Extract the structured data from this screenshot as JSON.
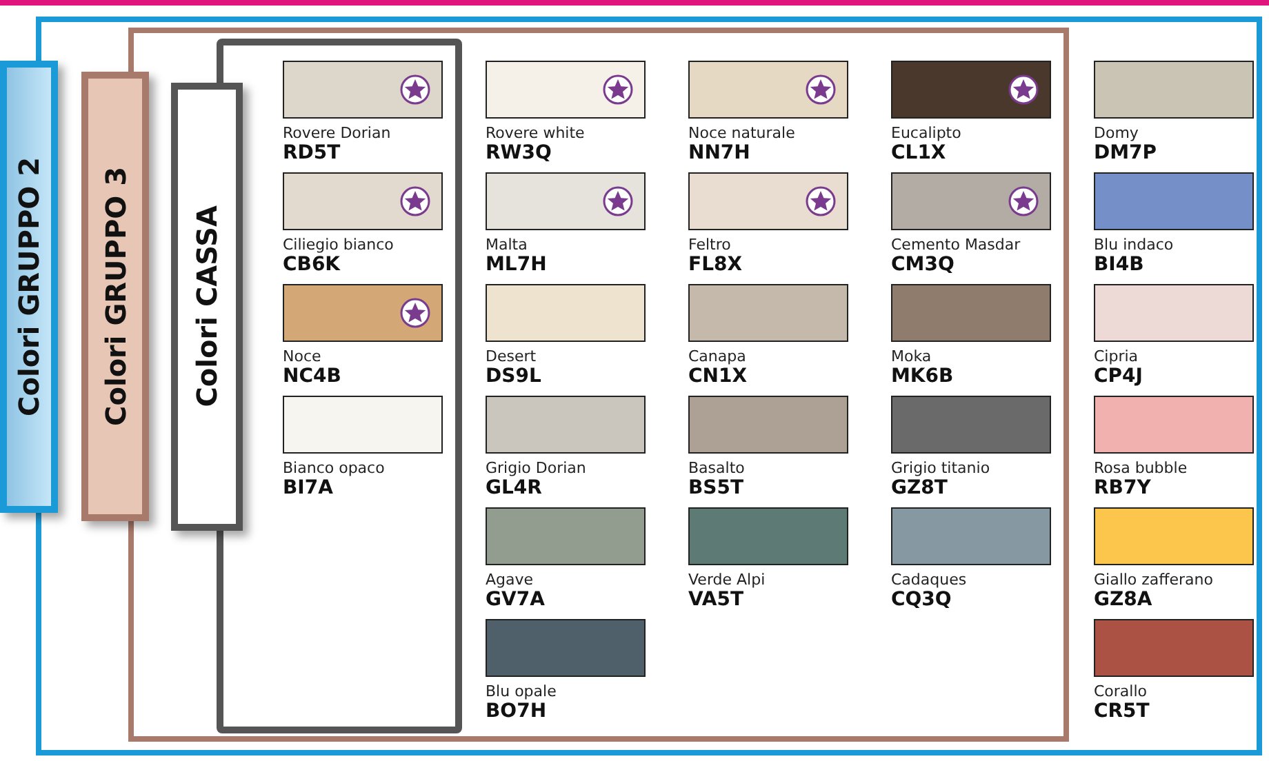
{
  "groups": [
    {
      "label": "Colori GRUPPO 2",
      "color": "#1a9ad6"
    },
    {
      "label": "Colori GRUPPO 3",
      "color": "#a87a6c"
    },
    {
      "label": "Colori CASSA",
      "color": "#555555"
    }
  ],
  "columns": [
    [
      {
        "name": "Rovere Dorian",
        "code": "RD5T",
        "color": "#ddd6cb",
        "starred": true
      },
      {
        "name": "Ciliegio bianco",
        "code": "CB6K",
        "color": "#e2d9cf",
        "starred": true
      },
      {
        "name": "Noce",
        "code": "NC4B",
        "color": "#d4a777",
        "starred": true
      },
      {
        "name": "Bianco opaco",
        "code": "BI7A",
        "color": "#f7f5ef",
        "starred": false
      }
    ],
    [
      {
        "name": "Rovere white",
        "code": "RW3Q",
        "color": "#f5f1e8",
        "starred": true
      },
      {
        "name": "Malta",
        "code": "ML7H",
        "color": "#e6e3dd",
        "starred": true
      },
      {
        "name": "Desert",
        "code": "DS9L",
        "color": "#ede3cf",
        "starred": false
      },
      {
        "name": "Grigio Dorian",
        "code": "GL4R",
        "color": "#cbc6bd",
        "starred": false
      },
      {
        "name": "Agave",
        "code": "GV7A",
        "color": "#939d8f",
        "starred": false
      },
      {
        "name": "Blu opale",
        "code": "BO7H",
        "color": "#4f606b",
        "starred": false
      }
    ],
    [
      {
        "name": "Noce naturale",
        "code": "NN7H",
        "color": "#e6d9c4",
        "starred": true
      },
      {
        "name": "Feltro",
        "code": "FL8X",
        "color": "#e8ddd0",
        "starred": true
      },
      {
        "name": "Canapa",
        "code": "CN1X",
        "color": "#c5b9ab",
        "starred": false
      },
      {
        "name": "Basalto",
        "code": "BS5T",
        "color": "#ada095",
        "starred": false
      },
      {
        "name": "Verde Alpi",
        "code": "VA5T",
        "color": "#5e7a74",
        "starred": false
      }
    ],
    [
      {
        "name": "Eucalipto",
        "code": "CL1X",
        "color": "#4a382d",
        "starred": true
      },
      {
        "name": "Cemento Masdar",
        "code": "CM3Q",
        "color": "#b3aca4",
        "starred": true
      },
      {
        "name": "Moka",
        "code": "MK6B",
        "color": "#8f7c6d",
        "starred": false
      },
      {
        "name": "Grigio titanio",
        "code": "GZ8T",
        "color": "#6a6a6a",
        "starred": false
      },
      {
        "name": "Cadaques",
        "code": "CQ3Q",
        "color": "#8699a3",
        "starred": false
      }
    ],
    [
      {
        "name": "Domy",
        "code": "DM7P",
        "color": "#cac4b4",
        "starred": false
      },
      {
        "name": "Blu indaco",
        "code": "BI4B",
        "color": "#7590c8",
        "starred": false
      },
      {
        "name": "Cipria",
        "code": "CP4J",
        "color": "#eddad6",
        "starred": false
      },
      {
        "name": "Rosa bubble",
        "code": "RB7Y",
        "color": "#f1b1ae",
        "starred": false
      },
      {
        "name": "Giallo zafferano",
        "code": "GZ8A",
        "color": "#fcc54c",
        "starred": false
      },
      {
        "name": "Corallo",
        "code": "CR5T",
        "color": "#ac5244",
        "starred": false
      }
    ]
  ]
}
